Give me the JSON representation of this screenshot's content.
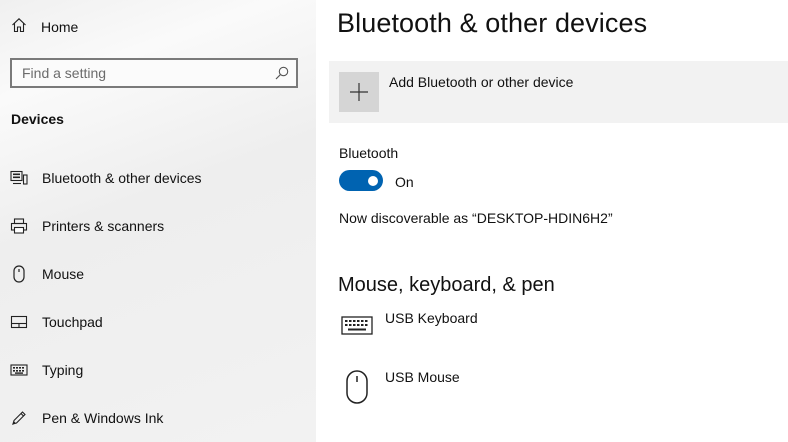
{
  "sidebar": {
    "home_label": "Home",
    "search_placeholder": "Find a setting",
    "section_title": "Devices",
    "items": [
      {
        "label": "Bluetooth & other devices",
        "icon": "bluetooth-devices-icon"
      },
      {
        "label": "Printers & scanners",
        "icon": "printer-icon"
      },
      {
        "label": "Mouse",
        "icon": "mouse-icon"
      },
      {
        "label": "Touchpad",
        "icon": "touchpad-icon"
      },
      {
        "label": "Typing",
        "icon": "keyboard-icon"
      },
      {
        "label": "Pen & Windows Ink",
        "icon": "pen-icon"
      }
    ]
  },
  "main": {
    "title": "Bluetooth & other devices",
    "add_device_label": "Add Bluetooth or other device",
    "bluetooth_label": "Bluetooth",
    "bluetooth_state": "On",
    "discoverable_text": "Now discoverable as “DESKTOP-HDIN6H2”",
    "section_heading": "Mouse, keyboard, & pen",
    "devices": [
      {
        "label": "USB Keyboard",
        "icon": "keyboard-icon"
      },
      {
        "label": "USB Mouse",
        "icon": "mouse-icon"
      }
    ]
  },
  "colors": {
    "accent": "#0063b1",
    "sidebar_bg": "#f2f2f2",
    "add_tile_bg": "#f2f2f2"
  }
}
